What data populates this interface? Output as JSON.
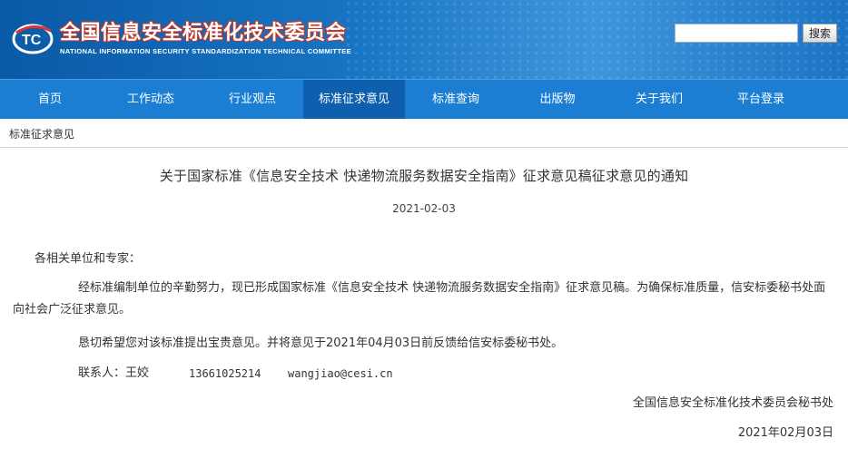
{
  "header": {
    "org_name_cn": "全国信息安全标准化技术委员会",
    "org_name_en": "NATIONAL INFORMATION SECURITY STANDARDIZATION TECHNICAL COMMITTEE",
    "logo_letters": "TC",
    "search_value": "",
    "search_button": "搜索"
  },
  "nav": {
    "items": [
      "首页",
      "工作动态",
      "行业观点",
      "标准征求意见",
      "标准查询",
      "出版物",
      "关于我们",
      "平台登录"
    ],
    "active_index": 3
  },
  "breadcrumb": "标准征求意见",
  "article": {
    "title": "关于国家标准《信息安全技术 快递物流服务数据安全指南》征求意见稿征求意见的通知",
    "date": "2021-02-03",
    "greeting": "各相关单位和专家：",
    "paragraph1": "经标准编制单位的辛勤努力，现已形成国家标准《信息安全技术 快递物流服务数据安全指南》征求意见稿。为确保标准质量，信安标委秘书处面向社会广泛征求意见。",
    "paragraph2": "恳切希望您对该标准提出宝贵意见。并将意见于2021年04月03日前反馈给信安标委秘书处。",
    "contact_label": "联系人：王姣",
    "contact_phone": "13661025214",
    "contact_email": "wangjiao@cesi.cn",
    "signature": "全国信息安全标准化技术委员会秘书处",
    "signature_date": "2021年02月03日"
  },
  "colors": {
    "nav_bg": "#1b7ed3",
    "nav_active": "#0e5fae",
    "header_bg": "#1470bf"
  }
}
